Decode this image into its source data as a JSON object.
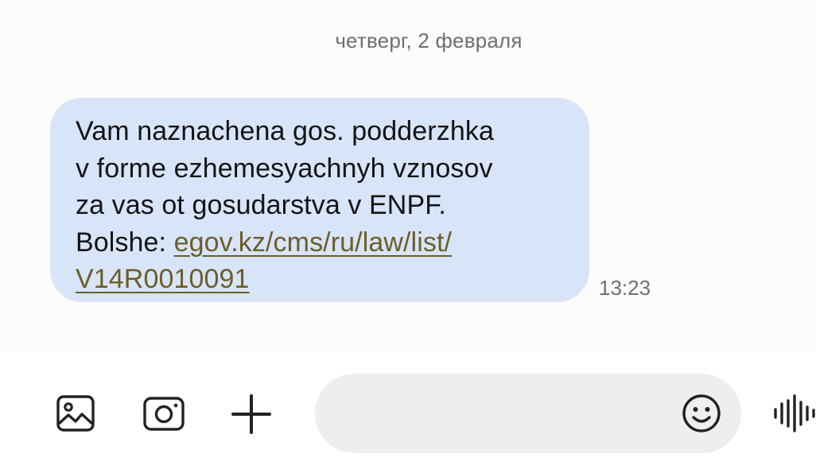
{
  "thread": {
    "date_separator": "четверг, 2 февраля",
    "message": {
      "line1": "Vam naznachena gos. podderzhka",
      "line2": "v forme ezhemesyachnyh vznosov",
      "line3": "za vas ot gosudarstva v ENPF.",
      "line4_prefix": "Bolshe: ",
      "link_part1": "egov.kz/cms/ru/law/list/",
      "link_part2": "V14R0010091",
      "time": "13:23"
    }
  },
  "composer": {
    "input_value": "",
    "icons": [
      "gallery-icon",
      "camera-icon",
      "plus-icon",
      "emoji-icon",
      "voice-waveform-icon"
    ]
  },
  "colors": {
    "bubble_bg": "#d8e4f8",
    "link": "#6b5e27",
    "meta_text": "#6f6f6f",
    "input_bg": "#eeeeee"
  }
}
